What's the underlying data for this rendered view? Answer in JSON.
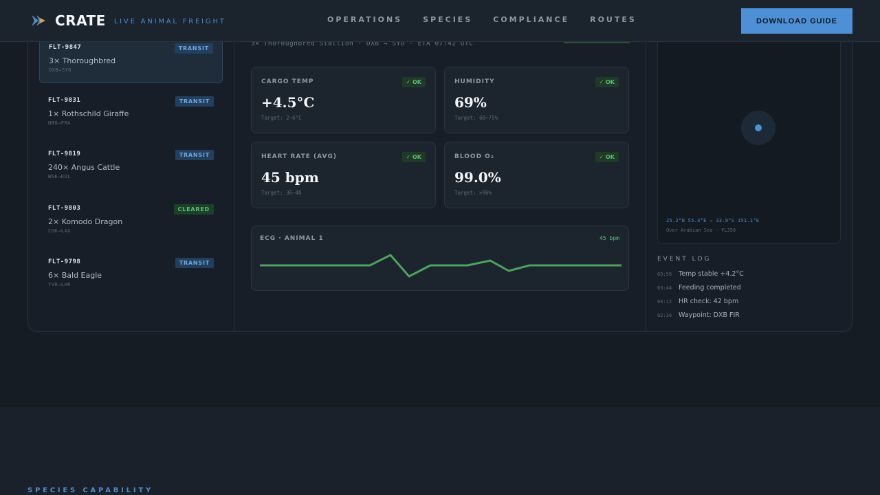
{
  "header": {
    "brand": "CRATE",
    "tagline": "LIVE ANIMAL FREIGHT",
    "nav": [
      "OPERATIONS",
      "SPECIES",
      "COMPLIANCE",
      "ROUTES"
    ],
    "cta": "DOWNLOAD GUIDE"
  },
  "flights": [
    {
      "id": "FLT-9847",
      "status": "TRANSIT",
      "desc": "3× Thoroughbred",
      "route": "DXB→SYD"
    },
    {
      "id": "FLT-9831",
      "status": "TRANSIT",
      "desc": "1× Rothschild Giraffe",
      "route": "NBO→FRA"
    },
    {
      "id": "FLT-9819",
      "status": "TRANSIT",
      "desc": "240× Angus Cattle",
      "route": "BNE→KUL"
    },
    {
      "id": "FLT-9803",
      "status": "CLEARED",
      "desc": "2× Komodo Dragon",
      "route": "CGK→LAX"
    },
    {
      "id": "FLT-9798",
      "status": "TRANSIT",
      "desc": "6× Bald Eagle",
      "route": "YVR→LHR"
    }
  ],
  "detail": {
    "subline": "3× Thoroughbred Stallion · DXB → SYD · ETA 07:42 UTC"
  },
  "metrics": [
    {
      "label": "CARGO TEMP",
      "status": "✓ OK",
      "value": "+4.5°C",
      "target": "Target: 2–6°C"
    },
    {
      "label": "HUMIDITY",
      "status": "✓ OK",
      "value": "69%",
      "target": "Target: 60–75%"
    },
    {
      "label": "HEART RATE (AVG)",
      "status": "✓ OK",
      "value": "45 bpm",
      "target": "Target: 36–48"
    },
    {
      "label": "BLOOD O₂",
      "status": "✓ OK",
      "value": "99.0%",
      "target": "Target: >96%"
    }
  ],
  "ecg": {
    "label": "ECG · ANIMAL 1",
    "bpm": "45 bpm",
    "color": "#4aa55a"
  },
  "map": {
    "coords": "25.2°N 55.4°E → 33.9°S 151.1°E",
    "region": "Over Arabian Sea · FL350"
  },
  "event_log": {
    "title": "EVENT LOG",
    "items": [
      {
        "time": "03:58",
        "text": "Temp stable +4.2°C"
      },
      {
        "time": "03:44",
        "text": "Feeding completed"
      },
      {
        "time": "03:12",
        "text": "HR check: 42 bpm"
      },
      {
        "time": "02:30",
        "text": "Waypoint: DXB FIR"
      }
    ]
  },
  "species_section": {
    "title": "SPECIES CAPABILITY"
  },
  "colors": {
    "accent": "#4d90d6",
    "ok": "#56c071",
    "background": "#161c24"
  }
}
